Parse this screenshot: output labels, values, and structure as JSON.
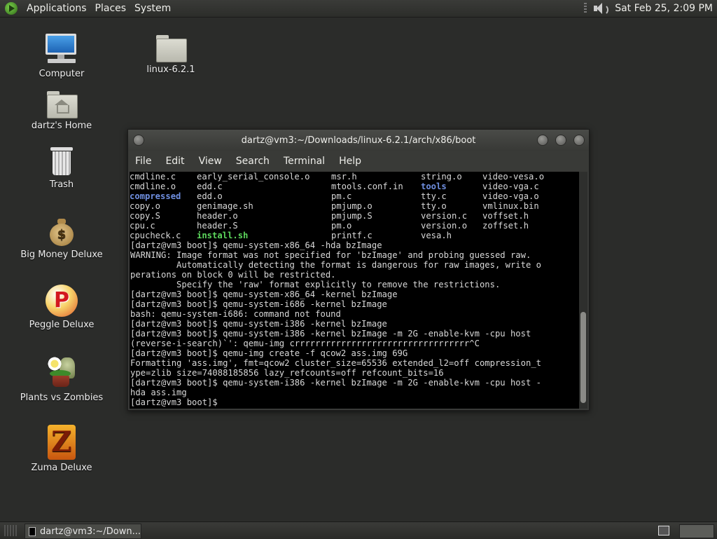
{
  "top_panel": {
    "menus": [
      "Applications",
      "Places",
      "System"
    ],
    "clock": "Sat Feb 25,  2:09 PM"
  },
  "desktop": {
    "icons": [
      {
        "label": "Computer",
        "icon": "computer-icon"
      },
      {
        "label": "linux-6.2.1",
        "icon": "folder-icon"
      },
      {
        "label": "dartz's Home",
        "icon": "home-folder-icon"
      },
      {
        "label": "Trash",
        "icon": "trash-icon"
      },
      {
        "label": "Big Money Deluxe",
        "icon": "money-bag-icon"
      },
      {
        "label": "Peggle Deluxe",
        "icon": "peggle-icon"
      },
      {
        "label": "Plants vs Zombies",
        "icon": "plants-vs-zombies-icon"
      },
      {
        "label": "Zuma Deluxe",
        "icon": "zuma-icon"
      }
    ]
  },
  "terminal": {
    "title": "dartz@vm3:~/Downloads/linux-6.2.1/arch/x86/boot",
    "menu": [
      "File",
      "Edit",
      "View",
      "Search",
      "Terminal",
      "Help"
    ],
    "ls_rows": [
      [
        "cmdline.c",
        "early_serial_console.o",
        "msr.h",
        "string.o",
        "video-vesa.o"
      ],
      [
        "cmdline.o",
        "edd.c",
        "mtools.conf.in",
        "tools",
        "video-vga.c"
      ],
      [
        "compressed",
        "edd.o",
        "pm.c",
        "tty.c",
        "video-vga.o"
      ],
      [
        "copy.o",
        "genimage.sh",
        "pmjump.o",
        "tty.o",
        "vmlinux.bin"
      ],
      [
        "copy.S",
        "header.o",
        "pmjump.S",
        "version.c",
        "voffset.h"
      ],
      [
        "cpu.c",
        "header.S",
        "pm.o",
        "version.o",
        "zoffset.h"
      ],
      [
        "cpucheck.c",
        "install.sh",
        "printf.c",
        "vesa.h",
        ""
      ]
    ],
    "dirs": [
      "compressed",
      "tools"
    ],
    "executables": [
      "install.sh"
    ],
    "lines": [
      "[dartz@vm3 boot]$ qemu-system-x86_64 -hda bzImage",
      "WARNING: Image format was not specified for 'bzImage' and probing guessed raw.",
      "         Automatically detecting the format is dangerous for raw images, write o",
      "perations on block 0 will be restricted.",
      "         Specify the 'raw' format explicitly to remove the restrictions.",
      "[dartz@vm3 boot]$ qemu-system-x86_64 -kernel bzImage",
      "[dartz@vm3 boot]$ qemu-system-i686 -kernel bzImage",
      "bash: qemu-system-i686: command not found",
      "[dartz@vm3 boot]$ qemu-system-i386 -kernel bzImage",
      "[dartz@vm3 boot]$ qemu-system-i386 -kernel bzImage -m 2G -enable-kvm -cpu host",
      "(reverse-i-search)`': qemu-img crrrrrrrrrrrrrrrrrrrrrrrrrrrrrrrrrr^C",
      "[dartz@vm3 boot]$ qemu-img create -f qcow2 ass.img 69G",
      "Formatting 'ass.img', fmt=qcow2 cluster_size=65536 extended_l2=off compression_t",
      "ype=zlib size=74088185856 lazy_refcounts=off refcount_bits=16",
      "[dartz@vm3 boot]$ qemu-system-i386 -kernel bzImage -m 2G -enable-kvm -cpu host -",
      "hda ass.img",
      "[dartz@vm3 boot]$ "
    ]
  },
  "taskbar": {
    "task_label": "dartz@vm3:~/Down..."
  }
}
